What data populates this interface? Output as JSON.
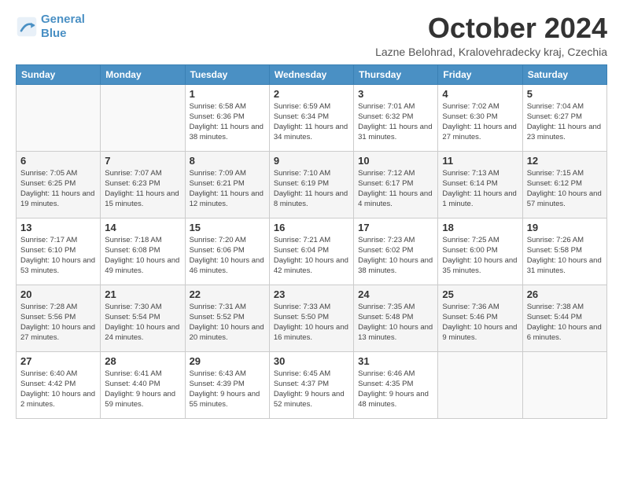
{
  "logo": {
    "line1": "General",
    "line2": "Blue"
  },
  "title": "October 2024",
  "subtitle": "Lazne Belohrad, Kralovehradecky kraj, Czechia",
  "headers": [
    "Sunday",
    "Monday",
    "Tuesday",
    "Wednesday",
    "Thursday",
    "Friday",
    "Saturday"
  ],
  "weeks": [
    [
      {
        "day": "",
        "detail": ""
      },
      {
        "day": "",
        "detail": ""
      },
      {
        "day": "1",
        "detail": "Sunrise: 6:58 AM\nSunset: 6:36 PM\nDaylight: 11 hours and 38 minutes."
      },
      {
        "day": "2",
        "detail": "Sunrise: 6:59 AM\nSunset: 6:34 PM\nDaylight: 11 hours and 34 minutes."
      },
      {
        "day": "3",
        "detail": "Sunrise: 7:01 AM\nSunset: 6:32 PM\nDaylight: 11 hours and 31 minutes."
      },
      {
        "day": "4",
        "detail": "Sunrise: 7:02 AM\nSunset: 6:30 PM\nDaylight: 11 hours and 27 minutes."
      },
      {
        "day": "5",
        "detail": "Sunrise: 7:04 AM\nSunset: 6:27 PM\nDaylight: 11 hours and 23 minutes."
      }
    ],
    [
      {
        "day": "6",
        "detail": "Sunrise: 7:05 AM\nSunset: 6:25 PM\nDaylight: 11 hours and 19 minutes."
      },
      {
        "day": "7",
        "detail": "Sunrise: 7:07 AM\nSunset: 6:23 PM\nDaylight: 11 hours and 15 minutes."
      },
      {
        "day": "8",
        "detail": "Sunrise: 7:09 AM\nSunset: 6:21 PM\nDaylight: 11 hours and 12 minutes."
      },
      {
        "day": "9",
        "detail": "Sunrise: 7:10 AM\nSunset: 6:19 PM\nDaylight: 11 hours and 8 minutes."
      },
      {
        "day": "10",
        "detail": "Sunrise: 7:12 AM\nSunset: 6:17 PM\nDaylight: 11 hours and 4 minutes."
      },
      {
        "day": "11",
        "detail": "Sunrise: 7:13 AM\nSunset: 6:14 PM\nDaylight: 11 hours and 1 minute."
      },
      {
        "day": "12",
        "detail": "Sunrise: 7:15 AM\nSunset: 6:12 PM\nDaylight: 10 hours and 57 minutes."
      }
    ],
    [
      {
        "day": "13",
        "detail": "Sunrise: 7:17 AM\nSunset: 6:10 PM\nDaylight: 10 hours and 53 minutes."
      },
      {
        "day": "14",
        "detail": "Sunrise: 7:18 AM\nSunset: 6:08 PM\nDaylight: 10 hours and 49 minutes."
      },
      {
        "day": "15",
        "detail": "Sunrise: 7:20 AM\nSunset: 6:06 PM\nDaylight: 10 hours and 46 minutes."
      },
      {
        "day": "16",
        "detail": "Sunrise: 7:21 AM\nSunset: 6:04 PM\nDaylight: 10 hours and 42 minutes."
      },
      {
        "day": "17",
        "detail": "Sunrise: 7:23 AM\nSunset: 6:02 PM\nDaylight: 10 hours and 38 minutes."
      },
      {
        "day": "18",
        "detail": "Sunrise: 7:25 AM\nSunset: 6:00 PM\nDaylight: 10 hours and 35 minutes."
      },
      {
        "day": "19",
        "detail": "Sunrise: 7:26 AM\nSunset: 5:58 PM\nDaylight: 10 hours and 31 minutes."
      }
    ],
    [
      {
        "day": "20",
        "detail": "Sunrise: 7:28 AM\nSunset: 5:56 PM\nDaylight: 10 hours and 27 minutes."
      },
      {
        "day": "21",
        "detail": "Sunrise: 7:30 AM\nSunset: 5:54 PM\nDaylight: 10 hours and 24 minutes."
      },
      {
        "day": "22",
        "detail": "Sunrise: 7:31 AM\nSunset: 5:52 PM\nDaylight: 10 hours and 20 minutes."
      },
      {
        "day": "23",
        "detail": "Sunrise: 7:33 AM\nSunset: 5:50 PM\nDaylight: 10 hours and 16 minutes."
      },
      {
        "day": "24",
        "detail": "Sunrise: 7:35 AM\nSunset: 5:48 PM\nDaylight: 10 hours and 13 minutes."
      },
      {
        "day": "25",
        "detail": "Sunrise: 7:36 AM\nSunset: 5:46 PM\nDaylight: 10 hours and 9 minutes."
      },
      {
        "day": "26",
        "detail": "Sunrise: 7:38 AM\nSunset: 5:44 PM\nDaylight: 10 hours and 6 minutes."
      }
    ],
    [
      {
        "day": "27",
        "detail": "Sunrise: 6:40 AM\nSunset: 4:42 PM\nDaylight: 10 hours and 2 minutes."
      },
      {
        "day": "28",
        "detail": "Sunrise: 6:41 AM\nSunset: 4:40 PM\nDaylight: 9 hours and 59 minutes."
      },
      {
        "day": "29",
        "detail": "Sunrise: 6:43 AM\nSunset: 4:39 PM\nDaylight: 9 hours and 55 minutes."
      },
      {
        "day": "30",
        "detail": "Sunrise: 6:45 AM\nSunset: 4:37 PM\nDaylight: 9 hours and 52 minutes."
      },
      {
        "day": "31",
        "detail": "Sunrise: 6:46 AM\nSunset: 4:35 PM\nDaylight: 9 hours and 48 minutes."
      },
      {
        "day": "",
        "detail": ""
      },
      {
        "day": "",
        "detail": ""
      }
    ]
  ]
}
